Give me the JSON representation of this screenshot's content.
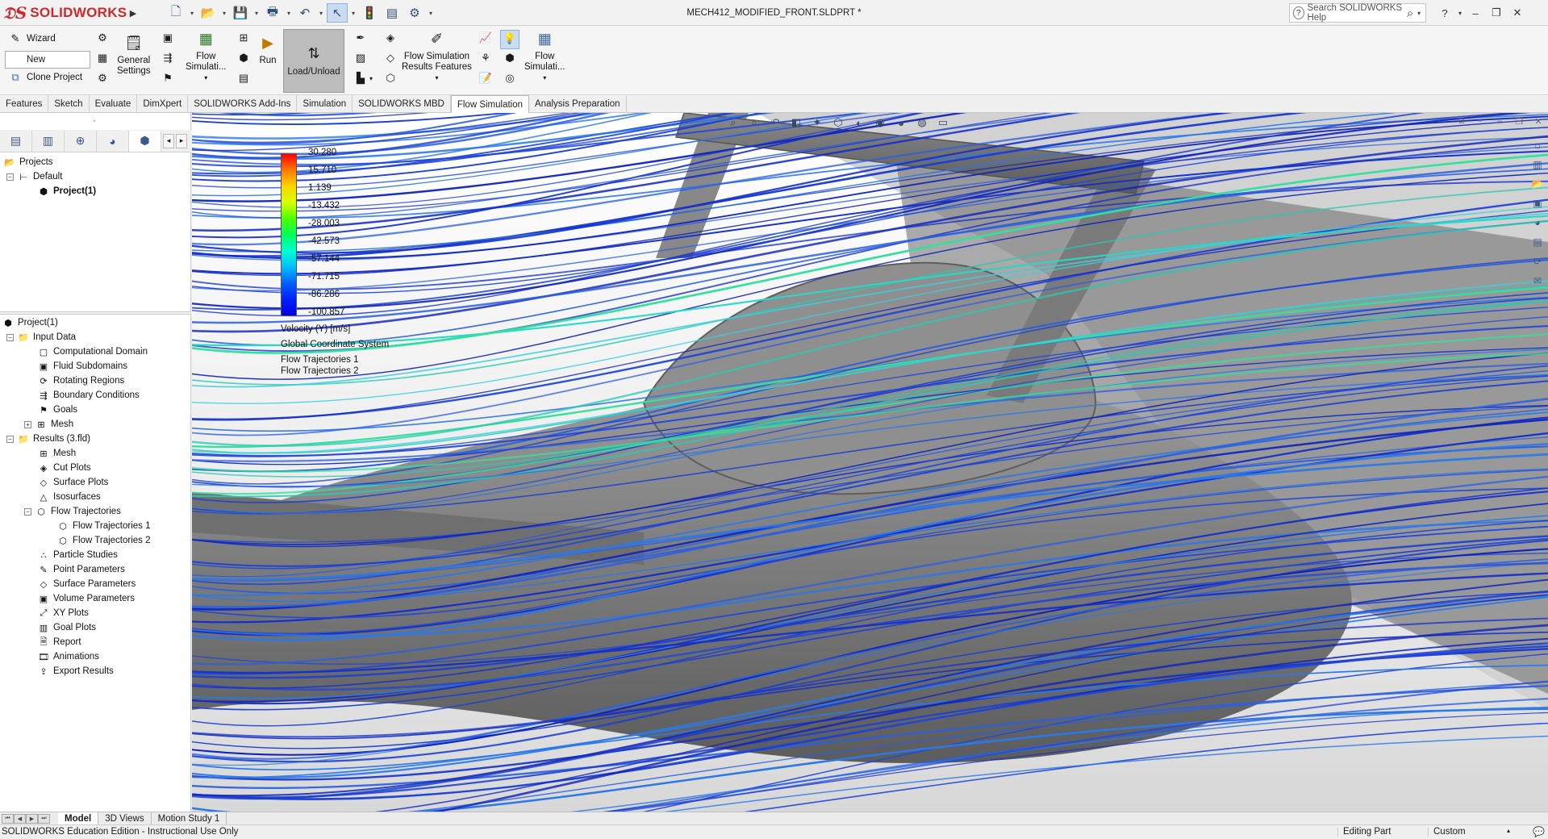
{
  "app": {
    "brand": "SOLIDWORKS",
    "document_title": "MECH412_MODIFIED_FRONT.SLDPRT *",
    "search_placeholder": "Search SOLIDWORKS Help",
    "colors": {
      "brand_red": "#d1262c",
      "selection_blue": "#c9dcf2"
    }
  },
  "quick_access": [
    {
      "icon": "new-document-icon"
    },
    {
      "icon": "open-folder-icon"
    },
    {
      "icon": "save-icon"
    },
    {
      "icon": "print-icon"
    },
    {
      "icon": "undo-icon"
    },
    {
      "icon": "select-arrow-icon"
    },
    {
      "icon": "traffic-light-icon"
    },
    {
      "icon": "file-properties-icon"
    },
    {
      "icon": "options-gear-icon"
    }
  ],
  "ribbon": {
    "wizard": "Wizard",
    "new": "New",
    "clone_project": "Clone Project",
    "general_settings_l1": "General",
    "general_settings_l2": "Settings",
    "flow_simulation_l1": "Flow",
    "flow_simulation_l2": "Simulati...",
    "run": "Run",
    "load_unload": "Load/Unload",
    "results_features_l1": "Flow Simulation",
    "results_features_l2": "Results Features",
    "flow_simulation2_l1": "Flow",
    "flow_simulation2_l2": "Simulati..."
  },
  "tabs": [
    "Features",
    "Sketch",
    "Evaluate",
    "DimXpert",
    "SOLIDWORKS Add-Ins",
    "Simulation",
    "SOLIDWORKS MBD",
    "Flow Simulation",
    "Analysis Preparation"
  ],
  "active_tab": "Flow Simulation",
  "projects_tree": {
    "root": "Projects",
    "default": "Default",
    "project": "Project(1)"
  },
  "analysis_tree": {
    "root": "Project(1)",
    "input_data": "Input Data",
    "input_items": [
      "Computational Domain",
      "Fluid Subdomains",
      "Rotating Regions",
      "Boundary Conditions",
      "Goals",
      "Mesh"
    ],
    "results": "Results (3.fld)",
    "result_items_a": [
      "Mesh",
      "Cut Plots",
      "Surface Plots",
      "Isosurfaces",
      "Flow Trajectories"
    ],
    "trajectories": [
      "Flow Trajectories 1",
      "Flow Trajectories 2"
    ],
    "result_items_b": [
      "Particle Studies",
      "Point Parameters",
      "Surface Parameters",
      "Volume Parameters",
      "XY Plots",
      "Goal Plots",
      "Report",
      "Animations",
      "Export Results"
    ]
  },
  "legend": {
    "ticks": [
      "30.280",
      "15.710",
      "1.139",
      "-13.432",
      "-28.003",
      "-42.573",
      "-57.144",
      "-71.715",
      "-86.286",
      "-100.857"
    ],
    "quantity": "Velocity (Y) [m/s]",
    "coordinate_system": "Global Coordinate System",
    "plot1": "Flow Trajectories 1",
    "plot2": "Flow Trajectories 2",
    "colormap": [
      "#ff0000",
      "#ff7a00",
      "#ffd400",
      "#d8ff00",
      "#4dff00",
      "#00ff5a",
      "#00ffd2",
      "#00bfff",
      "#0060ff",
      "#0020ff",
      "#0000e0"
    ]
  },
  "bottom_tabs": [
    "Model",
    "3D Views",
    "Motion Study 1"
  ],
  "active_bottom_tab": "Model",
  "status": {
    "edition": "SOLIDWORKS Education Edition - Instructional Use Only",
    "mode": "Editing Part",
    "units": "Custom"
  }
}
